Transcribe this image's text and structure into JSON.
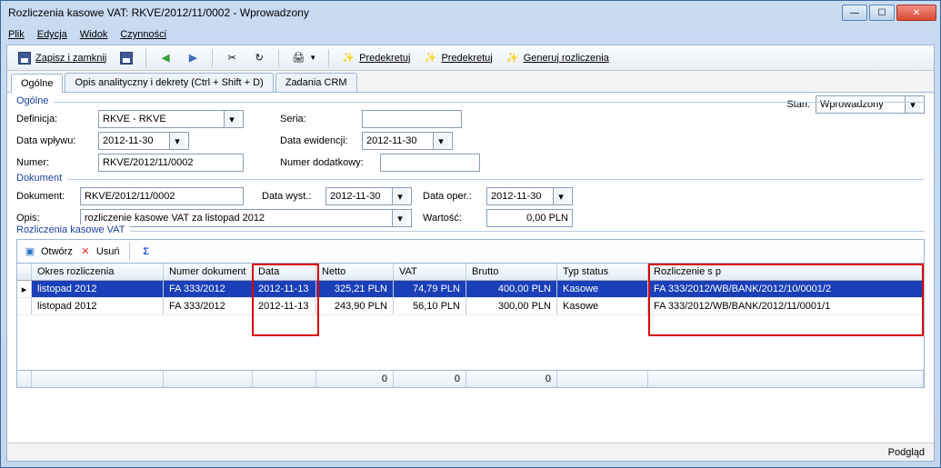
{
  "window": {
    "title": "Rozliczenia kasowe VAT: RKVE/2012/11/0002 - Wprowadzony"
  },
  "menubar": [
    "Plik",
    "Edycja",
    "Widok",
    "Czynności"
  ],
  "toolbar": {
    "save_close": "Zapisz i zamknij",
    "predekretuj1": "Predekretuj",
    "predekretuj2": "Predekretuj",
    "generuj": "Generuj rozliczenia"
  },
  "tabs": [
    "Ogólne",
    "Opis analityczny i dekrety (Ctrl + Shift + D)",
    "Zadania CRM"
  ],
  "stan": {
    "label": "Stan:",
    "value": "Wprowadzony"
  },
  "ogolne": {
    "legend": "Ogólne",
    "definicja_lbl": "Definicja:",
    "definicja": "RKVE - RKVE",
    "data_wplywu_lbl": "Data wpływu:",
    "data_wplywu": "2012-11-30",
    "numer_lbl": "Numer:",
    "numer": "RKVE/2012/11/0002",
    "seria_lbl": "Seria:",
    "seria": "",
    "data_ewid_lbl": "Data ewidencji:",
    "data_ewid": "2012-11-30",
    "numer_dod_lbl": "Numer dodatkowy:",
    "numer_dod": ""
  },
  "dokument": {
    "legend": "Dokument",
    "dok_lbl": "Dokument:",
    "dok": "RKVE/2012/11/0002",
    "data_wyst_lbl": "Data wyst.:",
    "data_wyst": "2012-11-30",
    "data_oper_lbl": "Data oper.:",
    "data_oper": "2012-11-30",
    "opis_lbl": "Opis:",
    "opis": "rozliczenie kasowe VAT za listopad 2012",
    "wartosc_lbl": "Wartość:",
    "wartosc": "0,00 PLN"
  },
  "rozl": {
    "legend": "Rozliczenia kasowe VAT",
    "tools": {
      "open": "Otwórz",
      "del": "Usuń"
    },
    "cols": [
      "Okres rozliczenia",
      "Numer dokument",
      "Data",
      "Netto",
      "VAT",
      "Brutto",
      "Typ status",
      "Rozliczenie s p"
    ],
    "rows": [
      {
        "okres": "listopad 2012",
        "nr": "FA 333/2012",
        "data": "2012-11-13",
        "netto": "325,21 PLN",
        "vat": "74,79 PLN",
        "brutto": "400,00 PLN",
        "typ": "Kasowe",
        "roz": "FA 333/2012/WB/BANK/2012/10/0001/2"
      },
      {
        "okres": "listopad 2012",
        "nr": "FA 333/2012",
        "data": "2012-11-13",
        "netto": "243,90 PLN",
        "vat": "56,10 PLN",
        "brutto": "300,00 PLN",
        "typ": "Kasowe",
        "roz": "FA 333/2012/WB/BANK/2012/11/0001/1"
      }
    ],
    "sums": {
      "netto": "0",
      "vat": "0",
      "brutto": "0"
    }
  },
  "status": {
    "podglad": "Podgląd"
  }
}
